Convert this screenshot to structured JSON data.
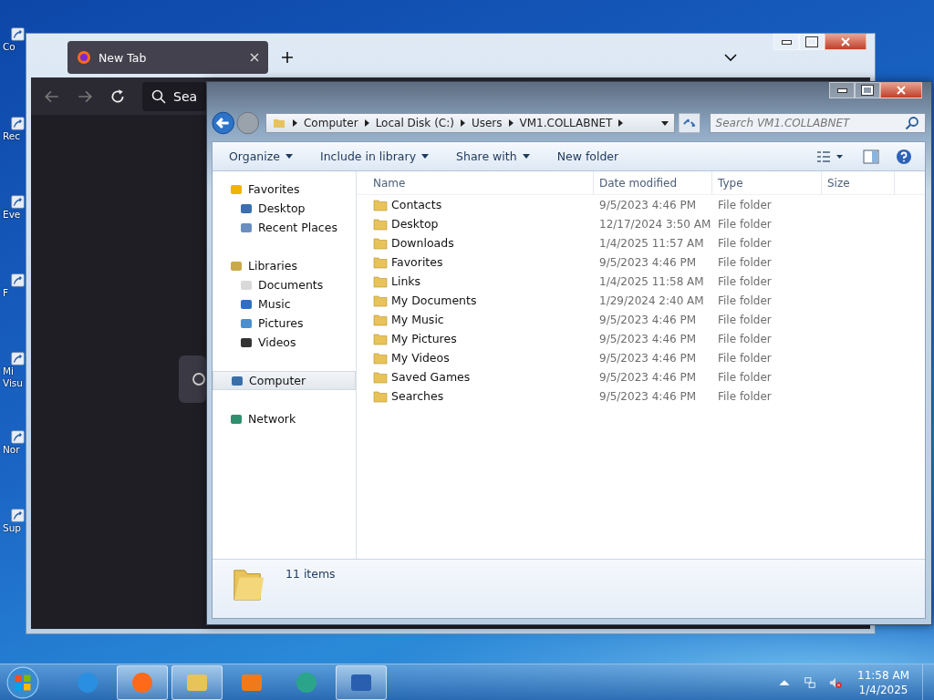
{
  "desktop_icons": [
    {
      "label": "Co"
    },
    {
      "label": "Rec"
    },
    {
      "label": "Eve"
    },
    {
      "label": "F"
    },
    {
      "label": "Mi\nVisu"
    },
    {
      "label": "Nor"
    },
    {
      "label": "Sup"
    }
  ],
  "browser": {
    "tabs": [
      {
        "label": "New Tab",
        "selected": true
      }
    ],
    "search": {
      "placeholder": "Sea"
    }
  },
  "explorer": {
    "breadcrumbs": [
      "Computer",
      "Local Disk (C:)",
      "Users",
      "VM1.COLLABNET"
    ],
    "search": {
      "placeholder": "Search VM1.COLLABNET"
    },
    "toolbar": [
      {
        "label": "Organize",
        "kind": "menu"
      },
      {
        "label": "Include in library",
        "kind": "menu"
      },
      {
        "label": "Share with",
        "kind": "menu"
      },
      {
        "label": "New folder",
        "kind": "plain"
      }
    ],
    "nav": [
      {
        "label": "Favorites",
        "kind": "star",
        "selected": false,
        "children": [
          {
            "label": "Desktop",
            "kind": "desktop",
            "selected": false
          },
          {
            "label": "Recent Places",
            "kind": "recent",
            "selected": false
          }
        ]
      },
      {
        "label": "Libraries",
        "kind": "library",
        "selected": false,
        "children": [
          {
            "label": "Documents",
            "kind": "doc",
            "selected": false
          },
          {
            "label": "Music",
            "kind": "music",
            "selected": false
          },
          {
            "label": "Pictures",
            "kind": "pic",
            "selected": false
          },
          {
            "label": "Videos",
            "kind": "video",
            "selected": false
          }
        ]
      },
      {
        "label": "Computer",
        "kind": "computer",
        "selected": true
      },
      {
        "label": "Network",
        "kind": "network",
        "selected": false
      }
    ],
    "columns": [
      "Name",
      "Date modified",
      "Type",
      "Size"
    ],
    "rows": [
      {
        "name": "Contacts",
        "date": "9/5/2023 4:46 PM",
        "type": "File folder"
      },
      {
        "name": "Desktop",
        "date": "12/17/2024 3:50 AM",
        "type": "File folder"
      },
      {
        "name": "Downloads",
        "date": "1/4/2025 11:57 AM",
        "type": "File folder"
      },
      {
        "name": "Favorites",
        "date": "9/5/2023 4:46 PM",
        "type": "File folder"
      },
      {
        "name": "Links",
        "date": "1/4/2025 11:58 AM",
        "type": "File folder"
      },
      {
        "name": "My Documents",
        "date": "1/29/2024 2:40 AM",
        "type": "File folder"
      },
      {
        "name": "My Music",
        "date": "9/5/2023 4:46 PM",
        "type": "File folder"
      },
      {
        "name": "My Pictures",
        "date": "9/5/2023 4:46 PM",
        "type": "File folder"
      },
      {
        "name": "My Videos",
        "date": "9/5/2023 4:46 PM",
        "type": "File folder"
      },
      {
        "name": "Saved Games",
        "date": "9/5/2023 4:46 PM",
        "type": "File folder"
      },
      {
        "name": "Searches",
        "date": "9/5/2023 4:46 PM",
        "type": "File folder"
      }
    ],
    "status": "11 items"
  },
  "taskbar": {
    "apps": [
      {
        "kind": "ie",
        "running": false
      },
      {
        "kind": "firefox",
        "running": true
      },
      {
        "kind": "explorer",
        "running": true
      },
      {
        "kind": "media",
        "running": false
      },
      {
        "kind": "globe",
        "running": false
      },
      {
        "kind": "shield",
        "running": true
      }
    ],
    "clock": {
      "time": "11:58 AM",
      "date": "1/4/2025"
    }
  }
}
